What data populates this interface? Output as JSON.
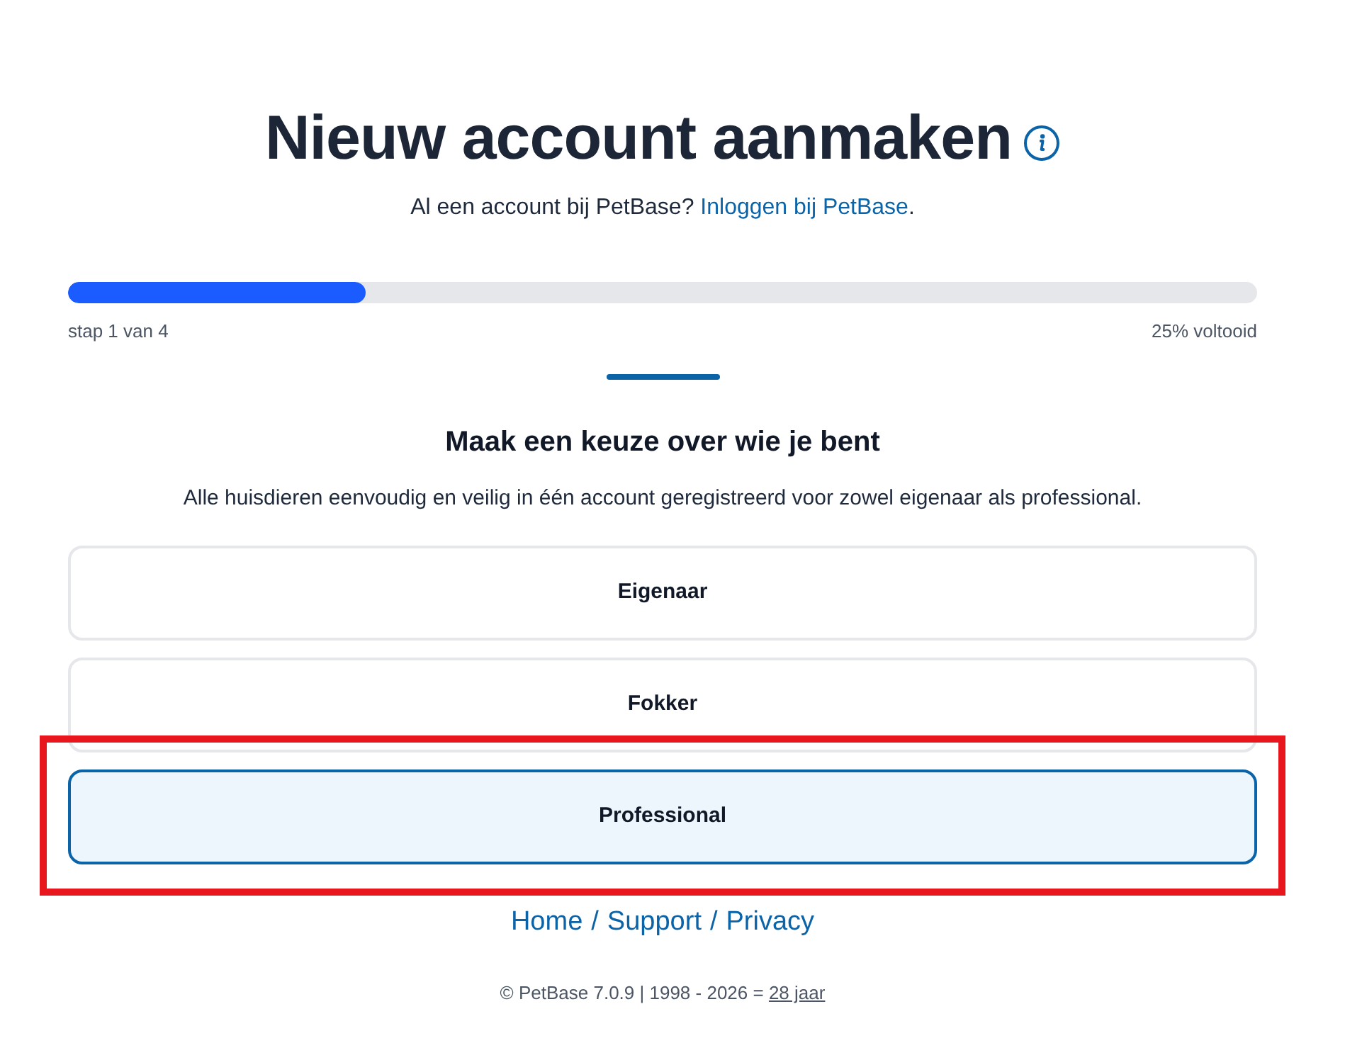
{
  "title": "Nieuw account aanmaken",
  "login_prompt": {
    "text": "Al een account bij PetBase?",
    "link": "Inloggen bij PetBase",
    "suffix": "."
  },
  "progress": {
    "level": 0.25,
    "step_label": "stap 1 van 4",
    "percent_label": "25% voltooid"
  },
  "section": {
    "heading": "Maak een keuze over wie je bent",
    "description": "Alle huisdieren eenvoudig en veilig in één account geregistreerd voor zowel eigenaar als professional."
  },
  "options": [
    {
      "label": "Eigenaar",
      "selected": false,
      "highlighted": false
    },
    {
      "label": "Fokker",
      "selected": false,
      "highlighted": false
    },
    {
      "label": "Professional",
      "selected": true,
      "highlighted": true
    }
  ],
  "footer": {
    "links": [
      "Home",
      "Support",
      "Privacy"
    ],
    "separator": "/"
  },
  "copyright": {
    "text": "© PetBase 7.0.9 | 1998 - 2026 =",
    "link": "28 jaar"
  }
}
